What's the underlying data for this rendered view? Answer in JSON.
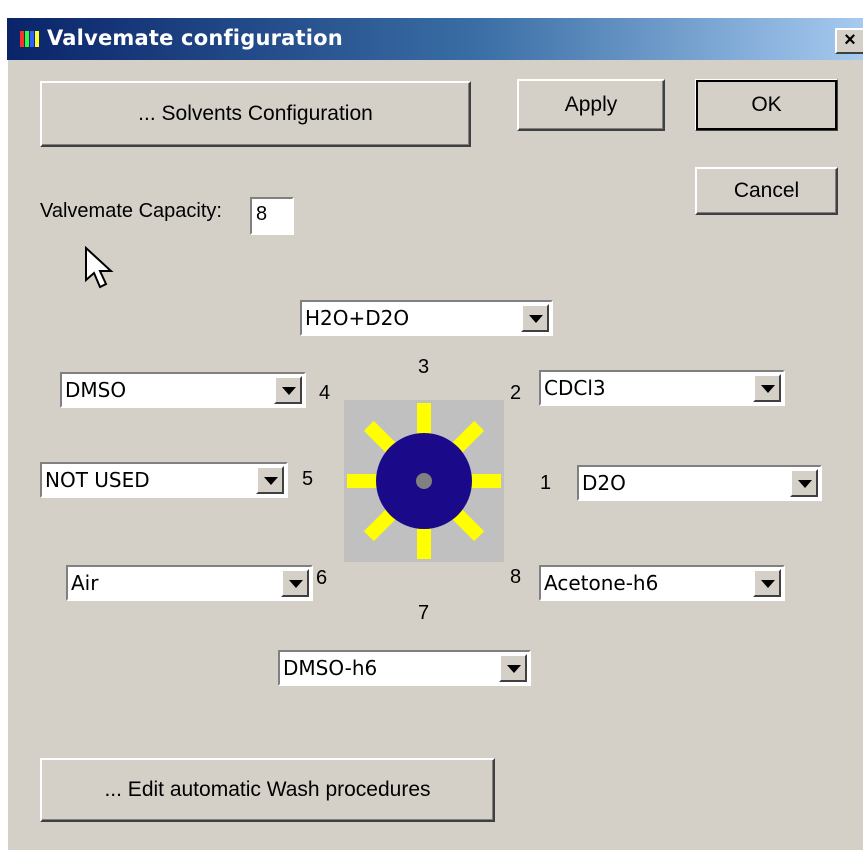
{
  "window": {
    "title": "Valvemate configuration",
    "close_label": "×"
  },
  "buttons": {
    "solvents": "... Solvents Configuration",
    "apply": "Apply",
    "ok": "OK",
    "cancel": "Cancel",
    "wash": "... Edit automatic Wash procedures"
  },
  "capacity": {
    "label": "Valvemate Capacity:",
    "value": "8"
  },
  "ports": [
    {
      "number": "1",
      "solvent": "D2O"
    },
    {
      "number": "2",
      "solvent": "CDCl3"
    },
    {
      "number": "3",
      "solvent": "H2O+D2O"
    },
    {
      "number": "4",
      "solvent": "DMSO"
    },
    {
      "number": "5",
      "solvent": "NOT USED"
    },
    {
      "number": "6",
      "solvent": "Air"
    },
    {
      "number": "7",
      "solvent": "DMSO-h6"
    },
    {
      "number": "8",
      "solvent": "Acetone-h6"
    }
  ],
  "colors": {
    "valve_body": "#1a0a8a",
    "valve_hub": "#808080",
    "valve_ports": "#ffff00",
    "valve_background": "#c0c0c0"
  },
  "icons": {
    "app": "valvemate-app-icon",
    "cursor": "mouse-pointer-icon",
    "dropdown": "chevron-down-icon"
  }
}
